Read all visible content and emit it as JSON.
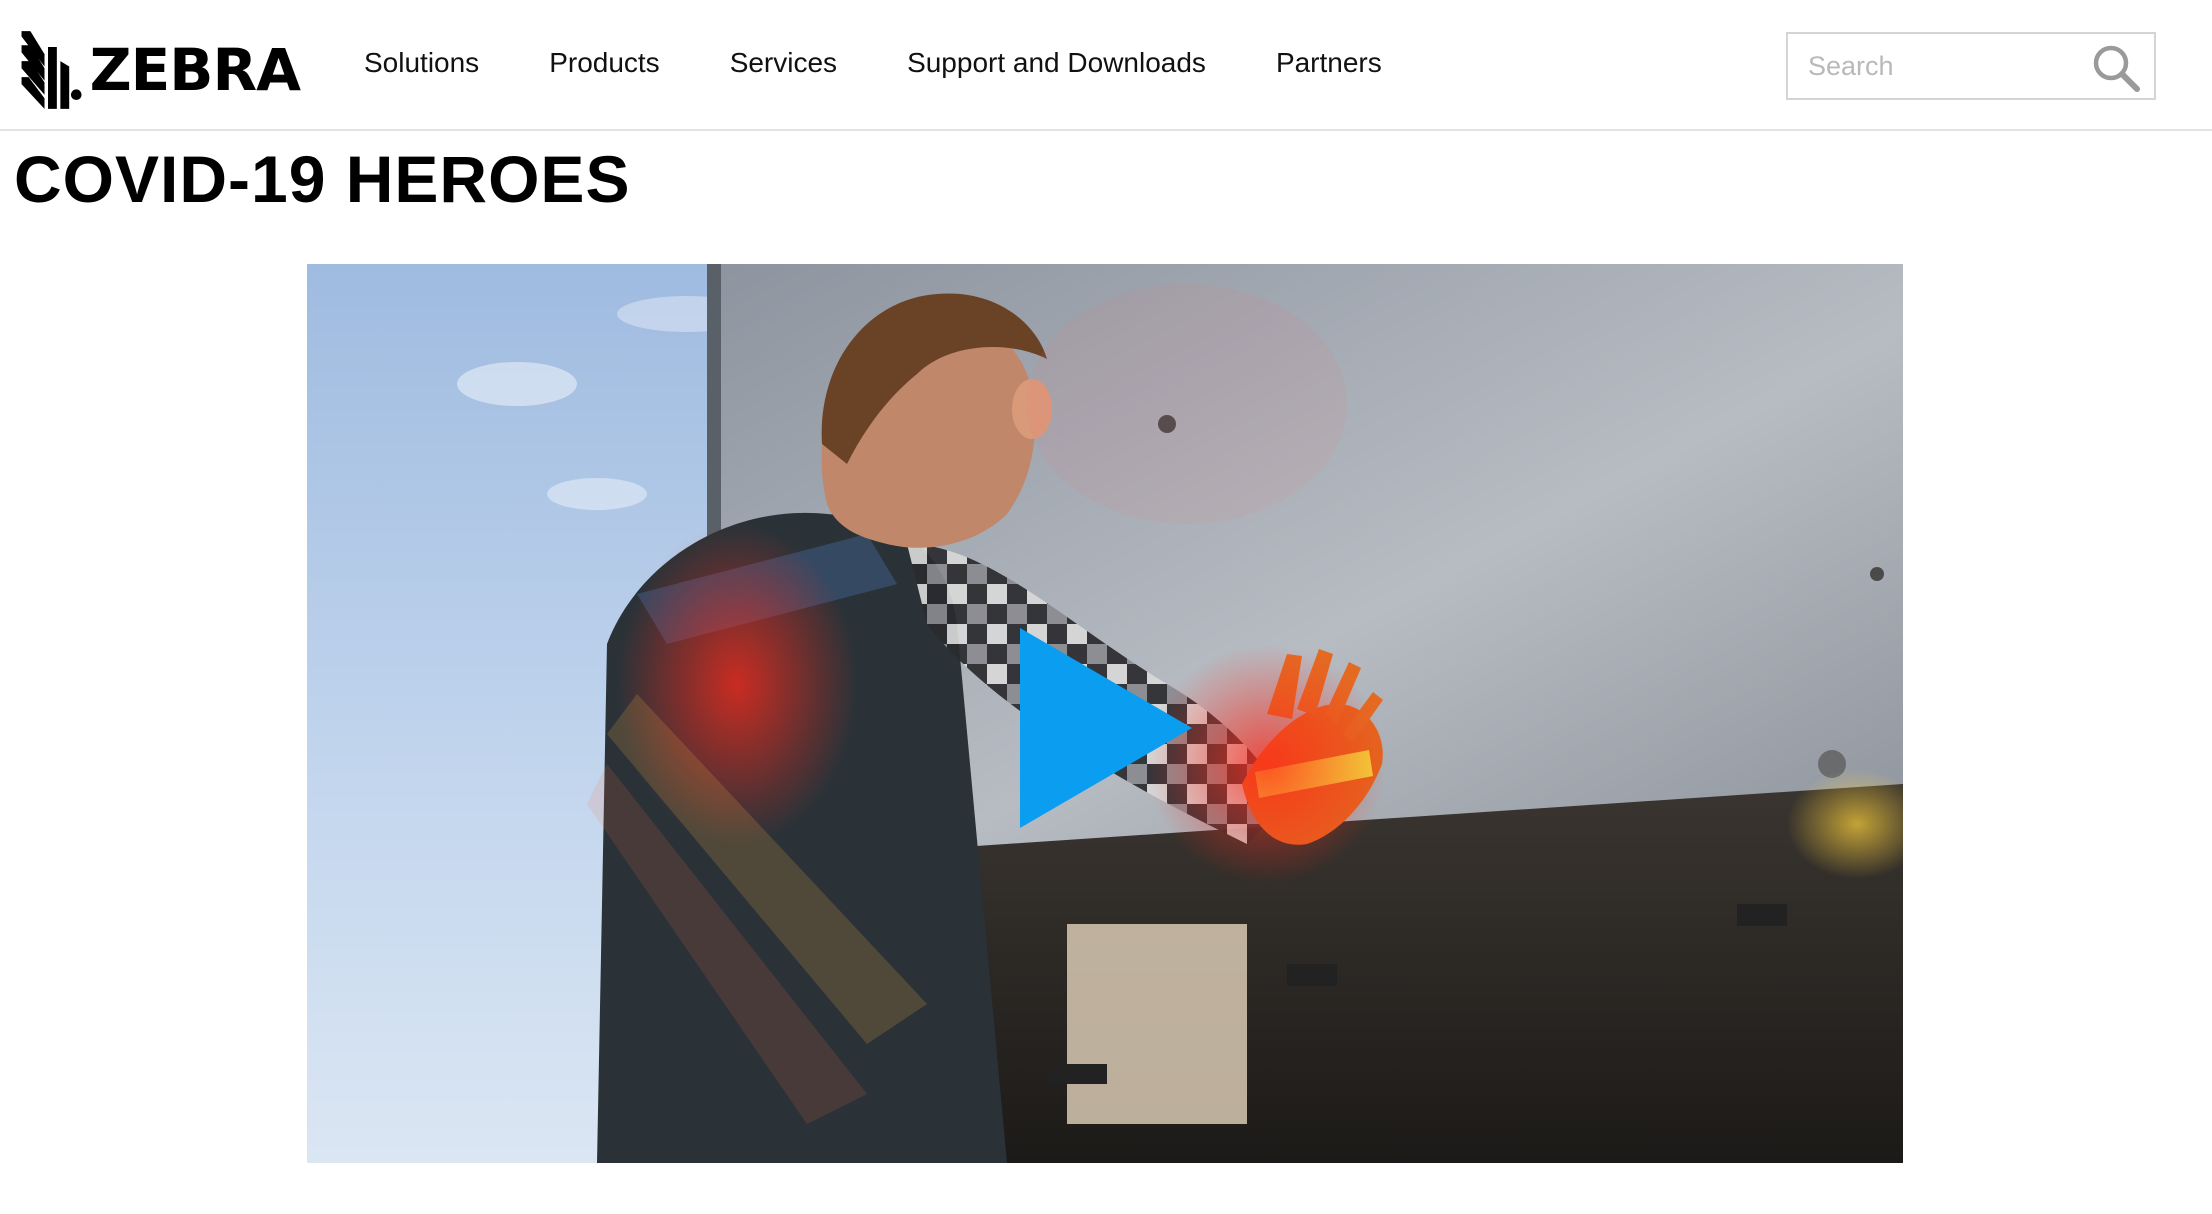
{
  "header": {
    "logo_text": "ZEBRA",
    "nav": [
      {
        "label": "Solutions"
      },
      {
        "label": "Products"
      },
      {
        "label": "Services"
      },
      {
        "label": "Support and Downloads"
      },
      {
        "label": "Partners"
      }
    ],
    "search": {
      "placeholder": "Search",
      "value": "",
      "icon": "search-icon"
    }
  },
  "main": {
    "title": "COVID-19 HEROES",
    "video": {
      "play_icon": "play-icon",
      "play_color": "#0a9df0"
    }
  },
  "colors": {
    "accent": "#0a9df0",
    "text": "#000000",
    "border": "#e3e3e3"
  }
}
